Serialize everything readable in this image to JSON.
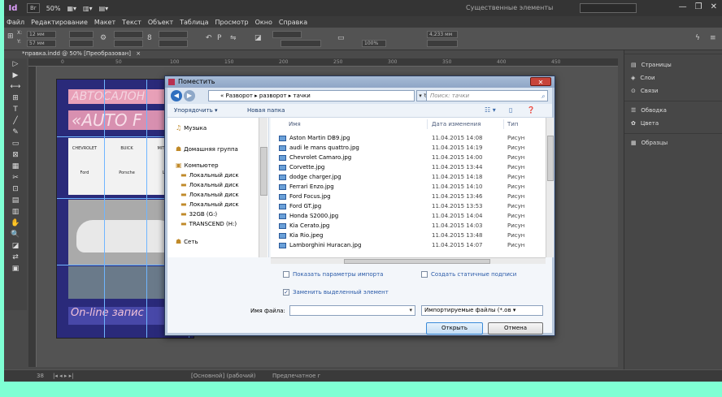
{
  "titlebar": {
    "app_logo": "Id",
    "bridge_btn": "Br",
    "zoom": "50%",
    "workspace": "Существенные элементы",
    "close_glyph": "✕",
    "minimize_glyph": "—"
  },
  "menu": [
    "Файл",
    "Редактирование",
    "Макет",
    "Текст",
    "Объект",
    "Таблица",
    "Просмотр",
    "Окно",
    "Справка"
  ],
  "controlbar": {
    "x_value": "12 мм",
    "y_value": "57 мм",
    "stroke_value": "4,233 мм",
    "scale_value": "100%"
  },
  "document_tab": {
    "title": "*правка.indd @ 50% [Преобразован]",
    "close": "×"
  },
  "ruler_ticks": [
    "0",
    "50",
    "100",
    "150",
    "200",
    "250",
    "300",
    "350",
    "400",
    "450"
  ],
  "tools": [
    "▷",
    "▶",
    "⟷",
    "⊞",
    "T",
    "╱",
    "✎",
    "▭",
    "⊠",
    "▦",
    "✂",
    "⊡",
    "▤",
    "▥",
    "✋",
    "🔍",
    "◪",
    "⇄",
    "▣"
  ],
  "page": {
    "headline1": "АВТОСАЛОН",
    "headline2": "«AUTO F",
    "online_text": "On-line запис",
    "logos": [
      "CHEVROLET",
      "BUICK",
      "MITSUBISHI",
      "Ford",
      "Porsche",
      "LEXUS"
    ]
  },
  "panels": [
    {
      "icon": "▤",
      "label": "Страницы"
    },
    {
      "icon": "◈",
      "label": "Слои"
    },
    {
      "icon": "⊙",
      "label": "Связи"
    },
    {
      "icon": "☰",
      "label": "Обводка"
    },
    {
      "icon": "✿",
      "label": "Цвета"
    },
    {
      "icon": "▦",
      "label": "Образцы"
    }
  ],
  "statusbar": {
    "page_number": "38",
    "status": "[Основной] (рабочий)",
    "preflight": "Предпечатное г"
  },
  "dialog": {
    "title": "Поместить",
    "close_glyph": "✕",
    "address": "«  Разворот  ▸  разворот  ▸  тачки",
    "search_placeholder": "Поиск: тачки",
    "organize": "Упорядочить ▾",
    "new_folder": "Новая папка",
    "nav_items": [
      {
        "icon": "♫",
        "label": "Музыка"
      },
      {
        "icon": "☗",
        "label": "Домашняя группа"
      },
      {
        "icon": "▣",
        "label": "Компьютер"
      },
      {
        "icon": "▬",
        "label": "Локальный диск"
      },
      {
        "icon": "▬",
        "label": "Локальный диск"
      },
      {
        "icon": "▬",
        "label": "Локальный диск"
      },
      {
        "icon": "▬",
        "label": "Локальный диск"
      },
      {
        "icon": "▬",
        "label": "32GB (G:)"
      },
      {
        "icon": "▬",
        "label": "TRANSCEND (H:)"
      },
      {
        "icon": "☗",
        "label": "Сеть"
      }
    ],
    "columns": {
      "name": "Имя",
      "date": "Дата изменения",
      "type": "Тип"
    },
    "files": [
      {
        "name": "Aston Martin DB9.jpg",
        "date": "11.04.2015 14:08",
        "type": "Рисун"
      },
      {
        "name": "audi le mans quattro.jpg",
        "date": "11.04.2015 14:19",
        "type": "Рисун"
      },
      {
        "name": "Chevrolet Camaro.jpg",
        "date": "11.04.2015 14:00",
        "type": "Рисун"
      },
      {
        "name": "Corvette.jpg",
        "date": "11.04.2015 13:44",
        "type": "Рисун"
      },
      {
        "name": "dodge charger.jpg",
        "date": "11.04.2015 14:18",
        "type": "Рисун"
      },
      {
        "name": "Ferrari Enzo.jpg",
        "date": "11.04.2015 14:10",
        "type": "Рисун"
      },
      {
        "name": "Ford Focus.jpg",
        "date": "11.04.2015 13:46",
        "type": "Рисун"
      },
      {
        "name": "Ford GT.jpg",
        "date": "11.04.2015 13:53",
        "type": "Рисун"
      },
      {
        "name": "Honda S2000.jpg",
        "date": "11.04.2015 14:04",
        "type": "Рисун"
      },
      {
        "name": "Kia Cerato.jpg",
        "date": "11.04.2015 14:03",
        "type": "Рисун"
      },
      {
        "name": "Kia Rio.jpeg",
        "date": "11.04.2015 13:48",
        "type": "Рисун"
      },
      {
        "name": "Lamborghini Huracan.jpg",
        "date": "11.04.2015 14:07",
        "type": "Рисун"
      }
    ],
    "show_options": "Показать параметры импорта",
    "replace_selected": "Заменить выделенный элемент",
    "create_captions": "Создать статичные подписи",
    "filename_label": "Имя файла:",
    "filename_value": "",
    "filetype": "Импортируемые файлы (*.ов ▾",
    "open_btn": "Открыть",
    "cancel_btn": "Отмена"
  }
}
